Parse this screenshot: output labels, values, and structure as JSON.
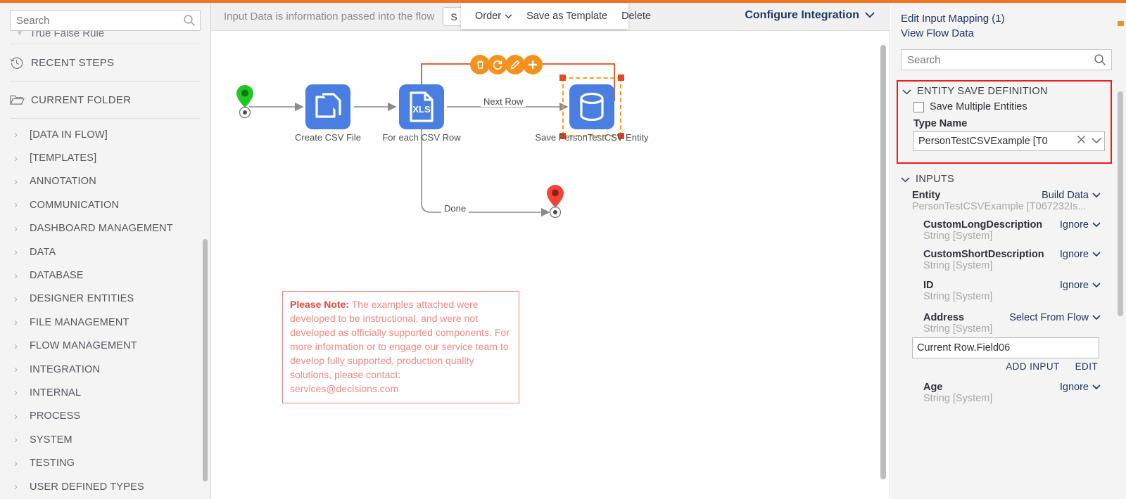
{
  "theme": {
    "accent": "#f37321",
    "node_blue": "#4a7ee0",
    "highlight_red": "#f31a1a",
    "link_navy": "#1f3864"
  },
  "sidebar": {
    "search": {
      "placeholder": "Search",
      "value": "",
      "icon": "search-icon"
    },
    "partial_item": {
      "label": "True False Rule"
    },
    "sections": [
      {
        "label": "RECENT STEPS",
        "icon": "history-clock-icon"
      },
      {
        "label": "CURRENT FOLDER",
        "icon": "folder-icon"
      }
    ],
    "items": [
      {
        "label": "[DATA IN FLOW]"
      },
      {
        "label": "[TEMPLATES]"
      },
      {
        "label": "ANNOTATION"
      },
      {
        "label": "COMMUNICATION"
      },
      {
        "label": "DASHBOARD MANAGEMENT"
      },
      {
        "label": "DATA"
      },
      {
        "label": "DATABASE"
      },
      {
        "label": "DESIGNER ENTITIES"
      },
      {
        "label": "FILE MANAGEMENT"
      },
      {
        "label": "FLOW MANAGEMENT"
      },
      {
        "label": "INTEGRATION"
      },
      {
        "label": "INTERNAL"
      },
      {
        "label": "PROCESS"
      },
      {
        "label": "SYSTEM"
      },
      {
        "label": "TESTING"
      },
      {
        "label": "USER DEFINED TYPES"
      }
    ]
  },
  "topbar": {
    "hint": "Input Data is information passed into the flow",
    "setup_button": "S",
    "configure_integration": "Configure Integration"
  },
  "context_menu": {
    "order": "Order",
    "save_as_template": "Save as Template",
    "delete": "Delete"
  },
  "canvas": {
    "nodes": [
      {
        "name": "start-marker",
        "label": "",
        "kind": "start-pin"
      },
      {
        "name": "create-csv-file",
        "label": "Create CSV File",
        "kind": "copy-documents-icon"
      },
      {
        "name": "for-each-csv-row",
        "label": "For each CSV Row",
        "kind": "xls-file-icon",
        "icon_text": "XLS"
      },
      {
        "name": "save-person-entity",
        "label": "Save PersonTestCSV Entity",
        "kind": "database-icon",
        "selected": true
      },
      {
        "name": "end-marker",
        "label": "",
        "kind": "end-pin"
      }
    ],
    "edge_labels": [
      {
        "text": "Next  Row"
      },
      {
        "text": "Done"
      }
    ],
    "action_bar": [
      {
        "name": "delete-step-button",
        "icon": "trash-icon",
        "glyph": "Ὕ1"
      },
      {
        "name": "refresh-step-button",
        "icon": "refresh-icon",
        "glyph": "⟳"
      },
      {
        "name": "edit-step-button",
        "icon": "pencil-icon",
        "glyph": "✎"
      },
      {
        "name": "add-step-button",
        "icon": "plus-icon",
        "glyph": "+"
      }
    ],
    "note": {
      "bold_prefix": "Please Note:",
      "body": " The examples attached were developed to be instructional, and were not developed as officially supported components. For more information or to engage our service team to develop fully supported, production quality solutions, please contact: services@decisions.com"
    }
  },
  "right_panel": {
    "links": [
      {
        "label": "Edit Input Mapping (1)"
      },
      {
        "label": "View Flow Data"
      }
    ],
    "search": {
      "placeholder": "Search",
      "value": "",
      "icon": "search-icon"
    },
    "entity_save_definition": {
      "title": "ENTITY SAVE DEFINITION",
      "save_multiple_entities": {
        "label": "Save Multiple Entities",
        "checked": false
      },
      "type_name_label": "Type Name",
      "type_name_value": "PersonTestCSVExample  [T0",
      "clear_icon": "close-icon",
      "dropdown_icon": "chevron-down-icon"
    },
    "inputs": {
      "title": "INPUTS",
      "entity": {
        "name": "Entity",
        "action": "Build Data",
        "type": "PersonTestCSVExample [T067232Is..."
      },
      "fields": [
        {
          "name": "CustomLongDescription",
          "action": "Ignore",
          "type": "String [System]"
        },
        {
          "name": "CustomShortDescription",
          "action": "Ignore",
          "type": "String [System]"
        },
        {
          "name": "ID",
          "action": "Ignore",
          "type": "String [System]"
        },
        {
          "name": "Address",
          "action": "Select From Flow",
          "type": "String [System]",
          "value": "Current Row.Field06",
          "highlighted": true,
          "links": [
            {
              "label": "ADD INPUT"
            },
            {
              "label": "EDIT"
            }
          ]
        },
        {
          "name": "Age",
          "action": "Ignore",
          "type": "String [System]"
        }
      ]
    }
  }
}
